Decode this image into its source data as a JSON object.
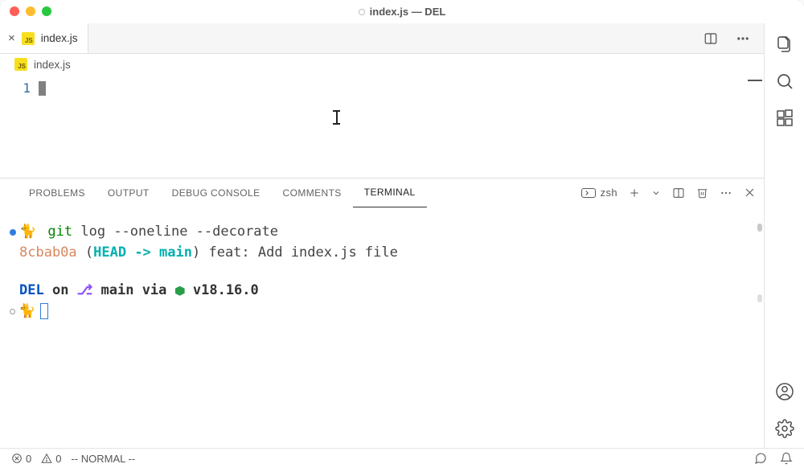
{
  "window": {
    "title": "index.js — DEL"
  },
  "tab": {
    "filename": "index.js"
  },
  "breadcrumb": {
    "filename": "index.js"
  },
  "editor": {
    "gutter": {
      "line1": "1"
    }
  },
  "tab_actions": {
    "split_title": "Split Editor",
    "more_title": "More Actions"
  },
  "panel": {
    "tabs": {
      "problems": "PROBLEMS",
      "output": "OUTPUT",
      "debug": "DEBUG CONSOLE",
      "comments": "COMMENTS",
      "terminal": "TERMINAL"
    },
    "shell": "zsh"
  },
  "terminal": {
    "prompt_emoji": "🐈",
    "line1": {
      "cmd_git": "git",
      "cmd_rest": " log --oneline --decorate"
    },
    "line2": {
      "hash": "8cbab0a",
      "paren_open": " (",
      "head": "HEAD -> ",
      "branch": "main",
      "paren_close": ")",
      "msg": " feat: Add index.js file"
    },
    "line3": {
      "del": "DEL",
      "on": " on ",
      "branch_sym": "⎇",
      "branch": " main",
      "via": " via ",
      "node": " v18.16.0"
    }
  },
  "status": {
    "errors": "0",
    "warnings": "0",
    "mode": "-- NORMAL --"
  }
}
